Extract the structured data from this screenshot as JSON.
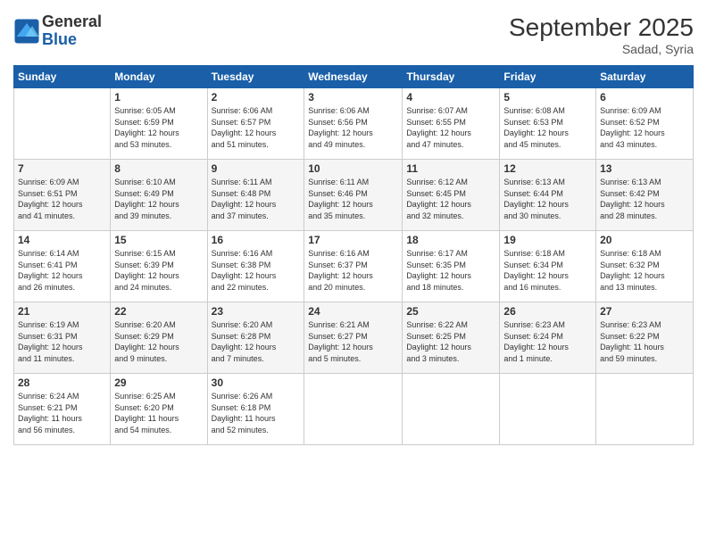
{
  "logo": {
    "line1": "General",
    "line2": "Blue"
  },
  "title": "September 2025",
  "location": "Sadad, Syria",
  "days_header": [
    "Sunday",
    "Monday",
    "Tuesday",
    "Wednesday",
    "Thursday",
    "Friday",
    "Saturday"
  ],
  "weeks": [
    [
      {
        "num": "",
        "info": ""
      },
      {
        "num": "1",
        "info": "Sunrise: 6:05 AM\nSunset: 6:59 PM\nDaylight: 12 hours\nand 53 minutes."
      },
      {
        "num": "2",
        "info": "Sunrise: 6:06 AM\nSunset: 6:57 PM\nDaylight: 12 hours\nand 51 minutes."
      },
      {
        "num": "3",
        "info": "Sunrise: 6:06 AM\nSunset: 6:56 PM\nDaylight: 12 hours\nand 49 minutes."
      },
      {
        "num": "4",
        "info": "Sunrise: 6:07 AM\nSunset: 6:55 PM\nDaylight: 12 hours\nand 47 minutes."
      },
      {
        "num": "5",
        "info": "Sunrise: 6:08 AM\nSunset: 6:53 PM\nDaylight: 12 hours\nand 45 minutes."
      },
      {
        "num": "6",
        "info": "Sunrise: 6:09 AM\nSunset: 6:52 PM\nDaylight: 12 hours\nand 43 minutes."
      }
    ],
    [
      {
        "num": "7",
        "info": "Sunrise: 6:09 AM\nSunset: 6:51 PM\nDaylight: 12 hours\nand 41 minutes."
      },
      {
        "num": "8",
        "info": "Sunrise: 6:10 AM\nSunset: 6:49 PM\nDaylight: 12 hours\nand 39 minutes."
      },
      {
        "num": "9",
        "info": "Sunrise: 6:11 AM\nSunset: 6:48 PM\nDaylight: 12 hours\nand 37 minutes."
      },
      {
        "num": "10",
        "info": "Sunrise: 6:11 AM\nSunset: 6:46 PM\nDaylight: 12 hours\nand 35 minutes."
      },
      {
        "num": "11",
        "info": "Sunrise: 6:12 AM\nSunset: 6:45 PM\nDaylight: 12 hours\nand 32 minutes."
      },
      {
        "num": "12",
        "info": "Sunrise: 6:13 AM\nSunset: 6:44 PM\nDaylight: 12 hours\nand 30 minutes."
      },
      {
        "num": "13",
        "info": "Sunrise: 6:13 AM\nSunset: 6:42 PM\nDaylight: 12 hours\nand 28 minutes."
      }
    ],
    [
      {
        "num": "14",
        "info": "Sunrise: 6:14 AM\nSunset: 6:41 PM\nDaylight: 12 hours\nand 26 minutes."
      },
      {
        "num": "15",
        "info": "Sunrise: 6:15 AM\nSunset: 6:39 PM\nDaylight: 12 hours\nand 24 minutes."
      },
      {
        "num": "16",
        "info": "Sunrise: 6:16 AM\nSunset: 6:38 PM\nDaylight: 12 hours\nand 22 minutes."
      },
      {
        "num": "17",
        "info": "Sunrise: 6:16 AM\nSunset: 6:37 PM\nDaylight: 12 hours\nand 20 minutes."
      },
      {
        "num": "18",
        "info": "Sunrise: 6:17 AM\nSunset: 6:35 PM\nDaylight: 12 hours\nand 18 minutes."
      },
      {
        "num": "19",
        "info": "Sunrise: 6:18 AM\nSunset: 6:34 PM\nDaylight: 12 hours\nand 16 minutes."
      },
      {
        "num": "20",
        "info": "Sunrise: 6:18 AM\nSunset: 6:32 PM\nDaylight: 12 hours\nand 13 minutes."
      }
    ],
    [
      {
        "num": "21",
        "info": "Sunrise: 6:19 AM\nSunset: 6:31 PM\nDaylight: 12 hours\nand 11 minutes."
      },
      {
        "num": "22",
        "info": "Sunrise: 6:20 AM\nSunset: 6:29 PM\nDaylight: 12 hours\nand 9 minutes."
      },
      {
        "num": "23",
        "info": "Sunrise: 6:20 AM\nSunset: 6:28 PM\nDaylight: 12 hours\nand 7 minutes."
      },
      {
        "num": "24",
        "info": "Sunrise: 6:21 AM\nSunset: 6:27 PM\nDaylight: 12 hours\nand 5 minutes."
      },
      {
        "num": "25",
        "info": "Sunrise: 6:22 AM\nSunset: 6:25 PM\nDaylight: 12 hours\nand 3 minutes."
      },
      {
        "num": "26",
        "info": "Sunrise: 6:23 AM\nSunset: 6:24 PM\nDaylight: 12 hours\nand 1 minute."
      },
      {
        "num": "27",
        "info": "Sunrise: 6:23 AM\nSunset: 6:22 PM\nDaylight: 11 hours\nand 59 minutes."
      }
    ],
    [
      {
        "num": "28",
        "info": "Sunrise: 6:24 AM\nSunset: 6:21 PM\nDaylight: 11 hours\nand 56 minutes."
      },
      {
        "num": "29",
        "info": "Sunrise: 6:25 AM\nSunset: 6:20 PM\nDaylight: 11 hours\nand 54 minutes."
      },
      {
        "num": "30",
        "info": "Sunrise: 6:26 AM\nSunset: 6:18 PM\nDaylight: 11 hours\nand 52 minutes."
      },
      {
        "num": "",
        "info": ""
      },
      {
        "num": "",
        "info": ""
      },
      {
        "num": "",
        "info": ""
      },
      {
        "num": "",
        "info": ""
      }
    ]
  ]
}
